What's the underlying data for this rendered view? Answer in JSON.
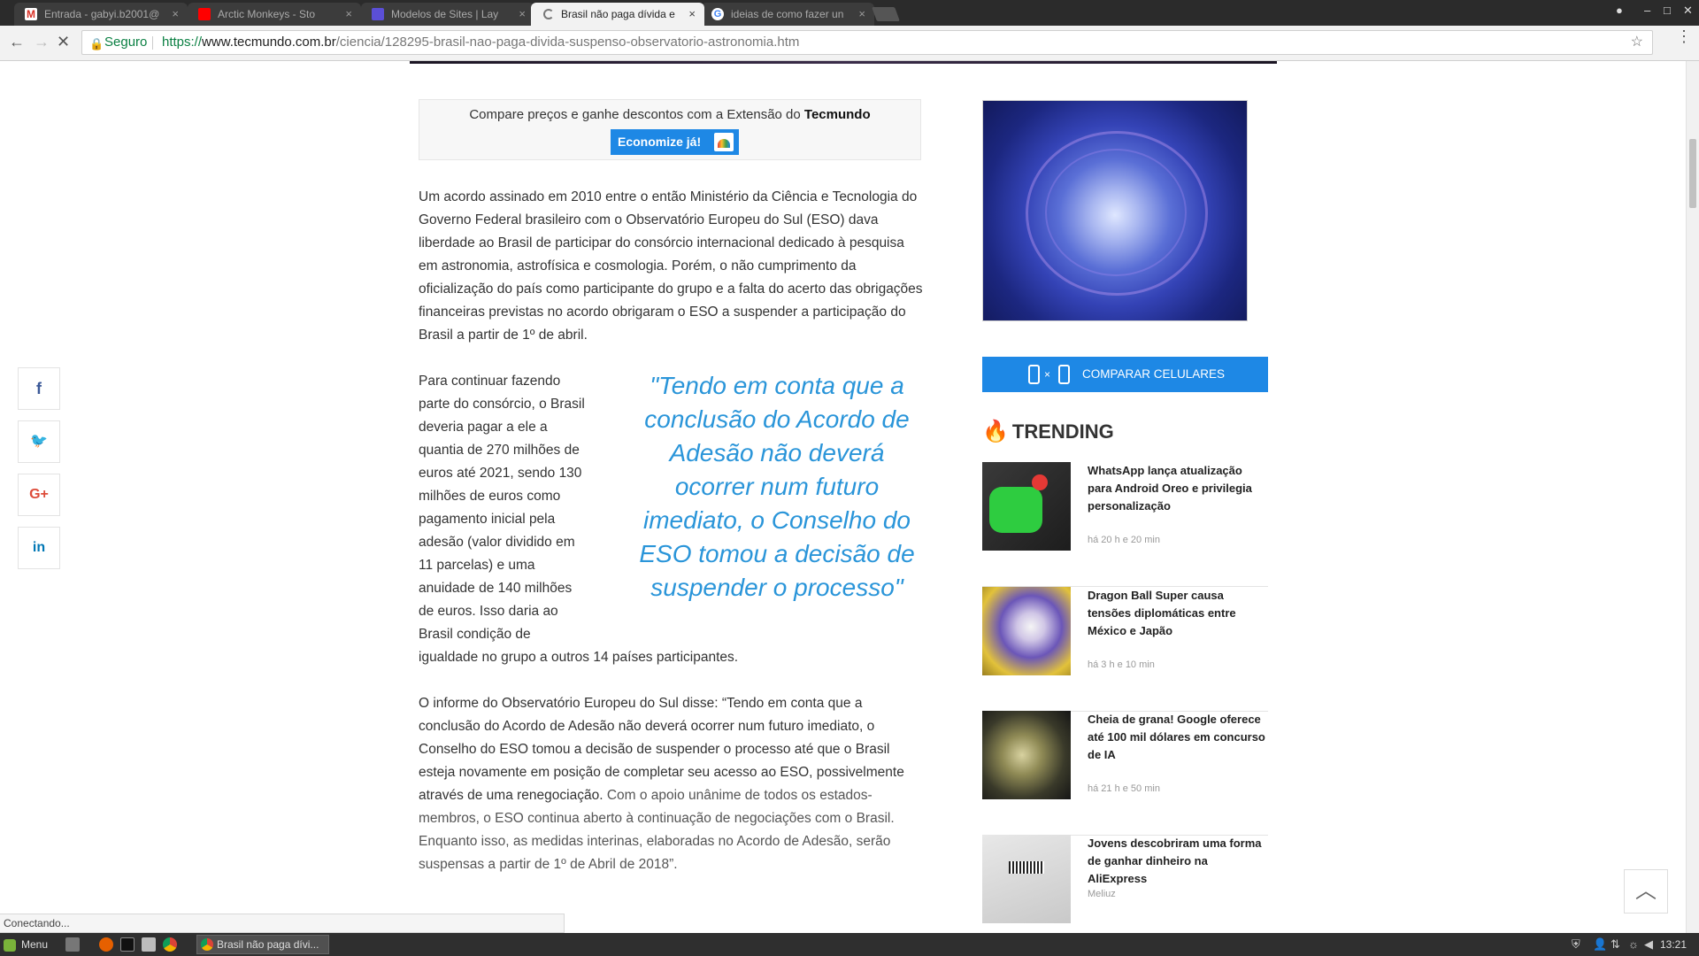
{
  "browser": {
    "tabs": [
      {
        "title": "Entrada - gabyi.b2001@",
        "icon": "gmail-icon",
        "color": "#d93025"
      },
      {
        "title": "Arctic Monkeys - Sto",
        "icon": "youtube-icon",
        "color": "#ff0000"
      },
      {
        "title": "Modelos de Sites | Lay",
        "icon": "site-icon",
        "color": "#5b4fd6"
      },
      {
        "title": "Brasil não paga dívida e",
        "icon": "loading-icon",
        "color": "#555555"
      },
      {
        "title": "ideias de como fazer un",
        "icon": "google-icon",
        "color": "#4285f4"
      }
    ],
    "close_glyph": "×",
    "secure_label": "Seguro",
    "url_protocol": "https://",
    "url_host": "www.tecmundo.com.br",
    "url_path": "/ciencia/128295-brasil-nao-paga-divida-suspenso-observatorio-astronomia.htm",
    "status_text": "Conectando..."
  },
  "promo": {
    "text_prefix": "Compare preços e ganhe descontos com a Extensão do ",
    "brand": "Tecmundo",
    "button_label": "Economize já!"
  },
  "article": {
    "p1": "Um acordo assinado em 2010 entre o então Ministério da Ciência e Tecnologia do Governo Federal brasileiro com o Observatório Europeu do Sul (ESO) dava liberdade ao Brasil de participar do consórcio internacional dedicado à pesquisa em astronomia, astrofísica e cosmologia. Porém, o não cumprimento da oficialização do país como participante do grupo e a falta do acerto das obrigações financeiras previstas no acordo obrigaram o ESO a suspender a participação do Brasil a partir de 1º de abril.",
    "p2_lines": [
      "Para continuar fazendo",
      "parte do consórcio, o Brasil",
      "deveria pagar a ele a",
      "quantia de 270 milhões de",
      "euros até 2021, sendo 130",
      "milhões de euros como",
      "pagamento inicial pela",
      "adesão (valor dividido em",
      "11 parcelas) e uma",
      "anuidade de 140 milhões",
      "de euros. Isso daria ao",
      "Brasil condição de"
    ],
    "p2_tail": "igualdade no grupo a outros 14 países participantes.",
    "quote": "\"Tendo em conta que a conclusão do Acordo de Adesão não deverá ocorrer num futuro imediato, o Conselho do ESO tomou a decisão de suspender o processo\"",
    "p3_main": "O informe do Observatório Europeu do Sul disse: “Tendo em conta que a conclusão do Acordo de Adesão não deverá ocorrer num futuro imediato, o Conselho do ESO tomou a decisão de suspender o processo até que o Brasil esteja novamente em posição de completar seu acesso ao ESO, possivelmente através de uma renegociação.",
    "p3_gray": " Com o apoio unânime de todos os estados-membros, o ESO continua aberto à continuação de negociações com o Brasil. Enquanto isso, as medidas interinas, elaboradas no Acordo de Adesão, serão suspensas a partir de 1º de Abril de 2018”."
  },
  "social": [
    {
      "name": "facebook",
      "glyph": "f",
      "color": "#3b5998"
    },
    {
      "name": "twitter",
      "glyph": "🐦",
      "color": "#1da1f2"
    },
    {
      "name": "google-plus",
      "glyph": "G+",
      "color": "#dd4b39"
    },
    {
      "name": "linkedin",
      "glyph": "in",
      "color": "#0077b5"
    }
  ],
  "sidebar": {
    "compare_label": "COMPARAR CELULARES",
    "compare_x": "×",
    "trending_label": "TRENDING",
    "items": [
      {
        "title": "WhatsApp lança atualização para Android Oreo e privilegia personalização",
        "meta": "há 20 h e 20 min",
        "source": ""
      },
      {
        "title": "Dragon Ball Super causa tensões diplomáticas entre México e Japão",
        "meta": "há 3 h e 10 min",
        "source": ""
      },
      {
        "title": "Cheia de grana! Google oferece até 100 mil dólares em concurso de IA",
        "meta": "há 21 h e 50 min",
        "source": ""
      },
      {
        "title": "Jovens descobriram uma forma de ganhar dinheiro na AliExpress",
        "meta": "",
        "source": "Meliuz"
      }
    ]
  },
  "taskbar": {
    "menu_label": "Menu",
    "window_title": "Brasil não paga dívi...",
    "clock": "13:21"
  }
}
